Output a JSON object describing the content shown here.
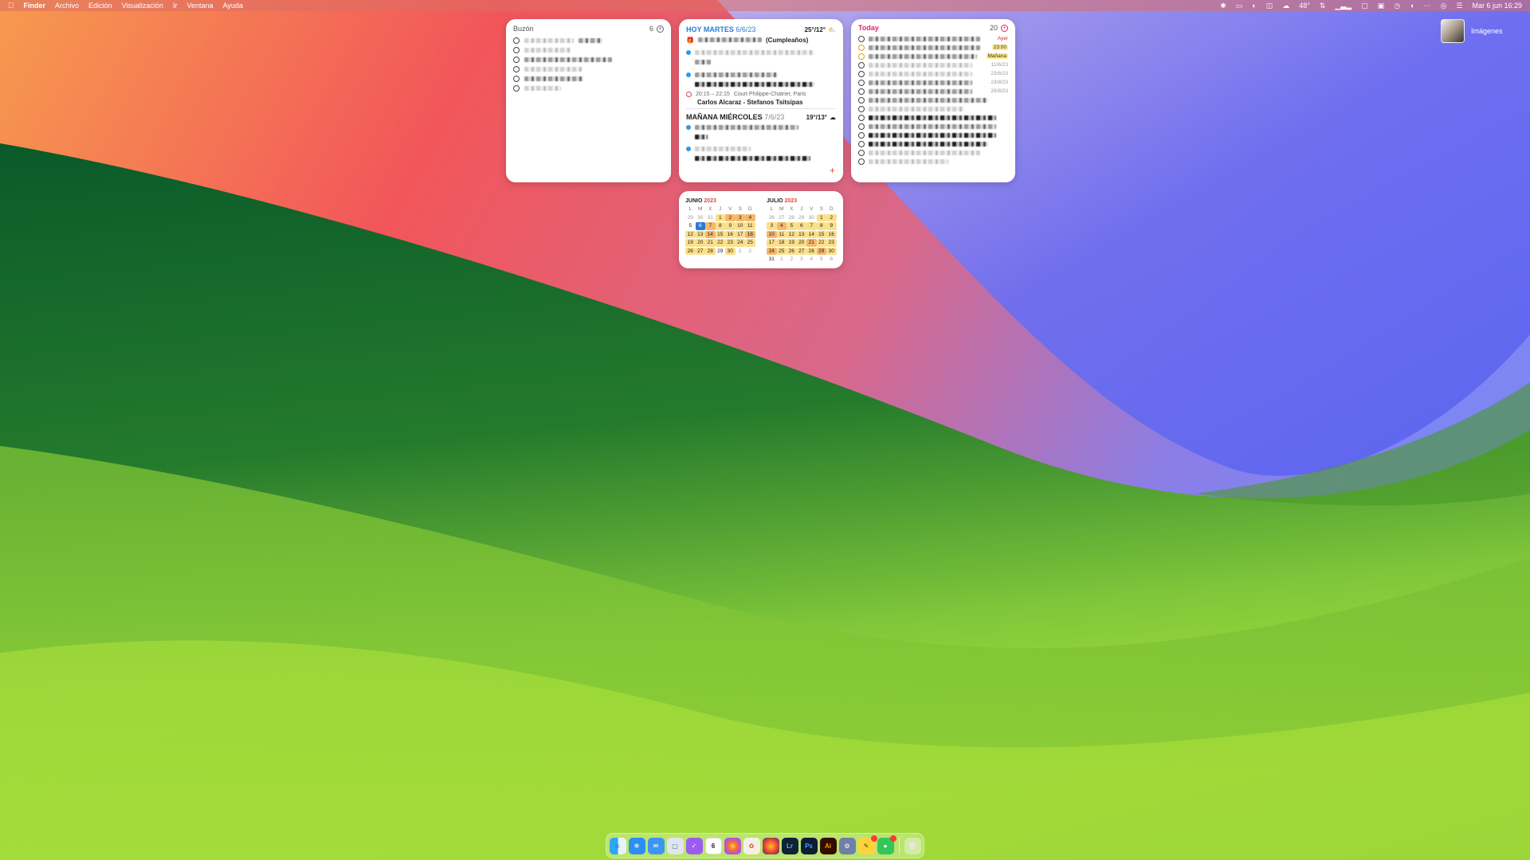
{
  "menubar": {
    "app_name": "Finder",
    "menus": [
      "Archivo",
      "Edición",
      "Visualización",
      "Ir",
      "Ventana",
      "Ayuda"
    ],
    "temperature": "48°",
    "clock": "Mar 6 jun 16:29"
  },
  "desktop": {
    "folder_label": "Imágenes"
  },
  "buzon": {
    "title": "Buzón",
    "count": "6"
  },
  "events": {
    "today_label": "HOY MARTES",
    "today_date": "6/6/23",
    "today_weather": "25°/12°",
    "birthday_label": "(Cumpleaños)",
    "match_time": "20:15 – 22:15",
    "match_place": "Court Philippe-Chatrier, Paris",
    "match_title": "Carlos Alcaraz - Stefanos Tsitsipas",
    "tomorrow_label": "MAÑANA MIÉRCOLES",
    "tomorrow_date": "7/6/23",
    "tomorrow_weather": "19°/13°"
  },
  "today_list": {
    "title": "Today",
    "count": "20",
    "due_labels": [
      "Ayer",
      "23:00",
      "Mañana",
      "11/6/23",
      "23/6/23",
      "23/8/23",
      "29/8/23"
    ]
  },
  "calendars": {
    "weekday_letters": [
      "L",
      "M",
      "X",
      "J",
      "V",
      "S",
      "D"
    ],
    "june": {
      "name": "JUNIO",
      "year": "2023",
      "days": [
        "29",
        "30",
        "31",
        "1",
        "2",
        "3",
        "4",
        "5",
        "6",
        "7",
        "8",
        "9",
        "10",
        "11",
        "12",
        "13",
        "14",
        "15",
        "16",
        "17",
        "18",
        "19",
        "20",
        "21",
        "22",
        "23",
        "24",
        "25",
        "26",
        "27",
        "28",
        "29",
        "30",
        "1",
        "2"
      ]
    },
    "july": {
      "name": "JULIO",
      "year": "2023",
      "days": [
        "26",
        "27",
        "28",
        "29",
        "30",
        "1",
        "2",
        "3",
        "4",
        "5",
        "6",
        "7",
        "8",
        "9",
        "10",
        "11",
        "12",
        "13",
        "14",
        "15",
        "16",
        "17",
        "18",
        "19",
        "20",
        "21",
        "22",
        "23",
        "24",
        "25",
        "26",
        "27",
        "28",
        "29",
        "30",
        "31",
        "1",
        "2",
        "3",
        "4",
        "5",
        "6"
      ]
    }
  },
  "dock": {
    "calendar_day": "6",
    "lightroom": "Lr",
    "photoshop": "Ps",
    "illustrator": "Ai"
  }
}
